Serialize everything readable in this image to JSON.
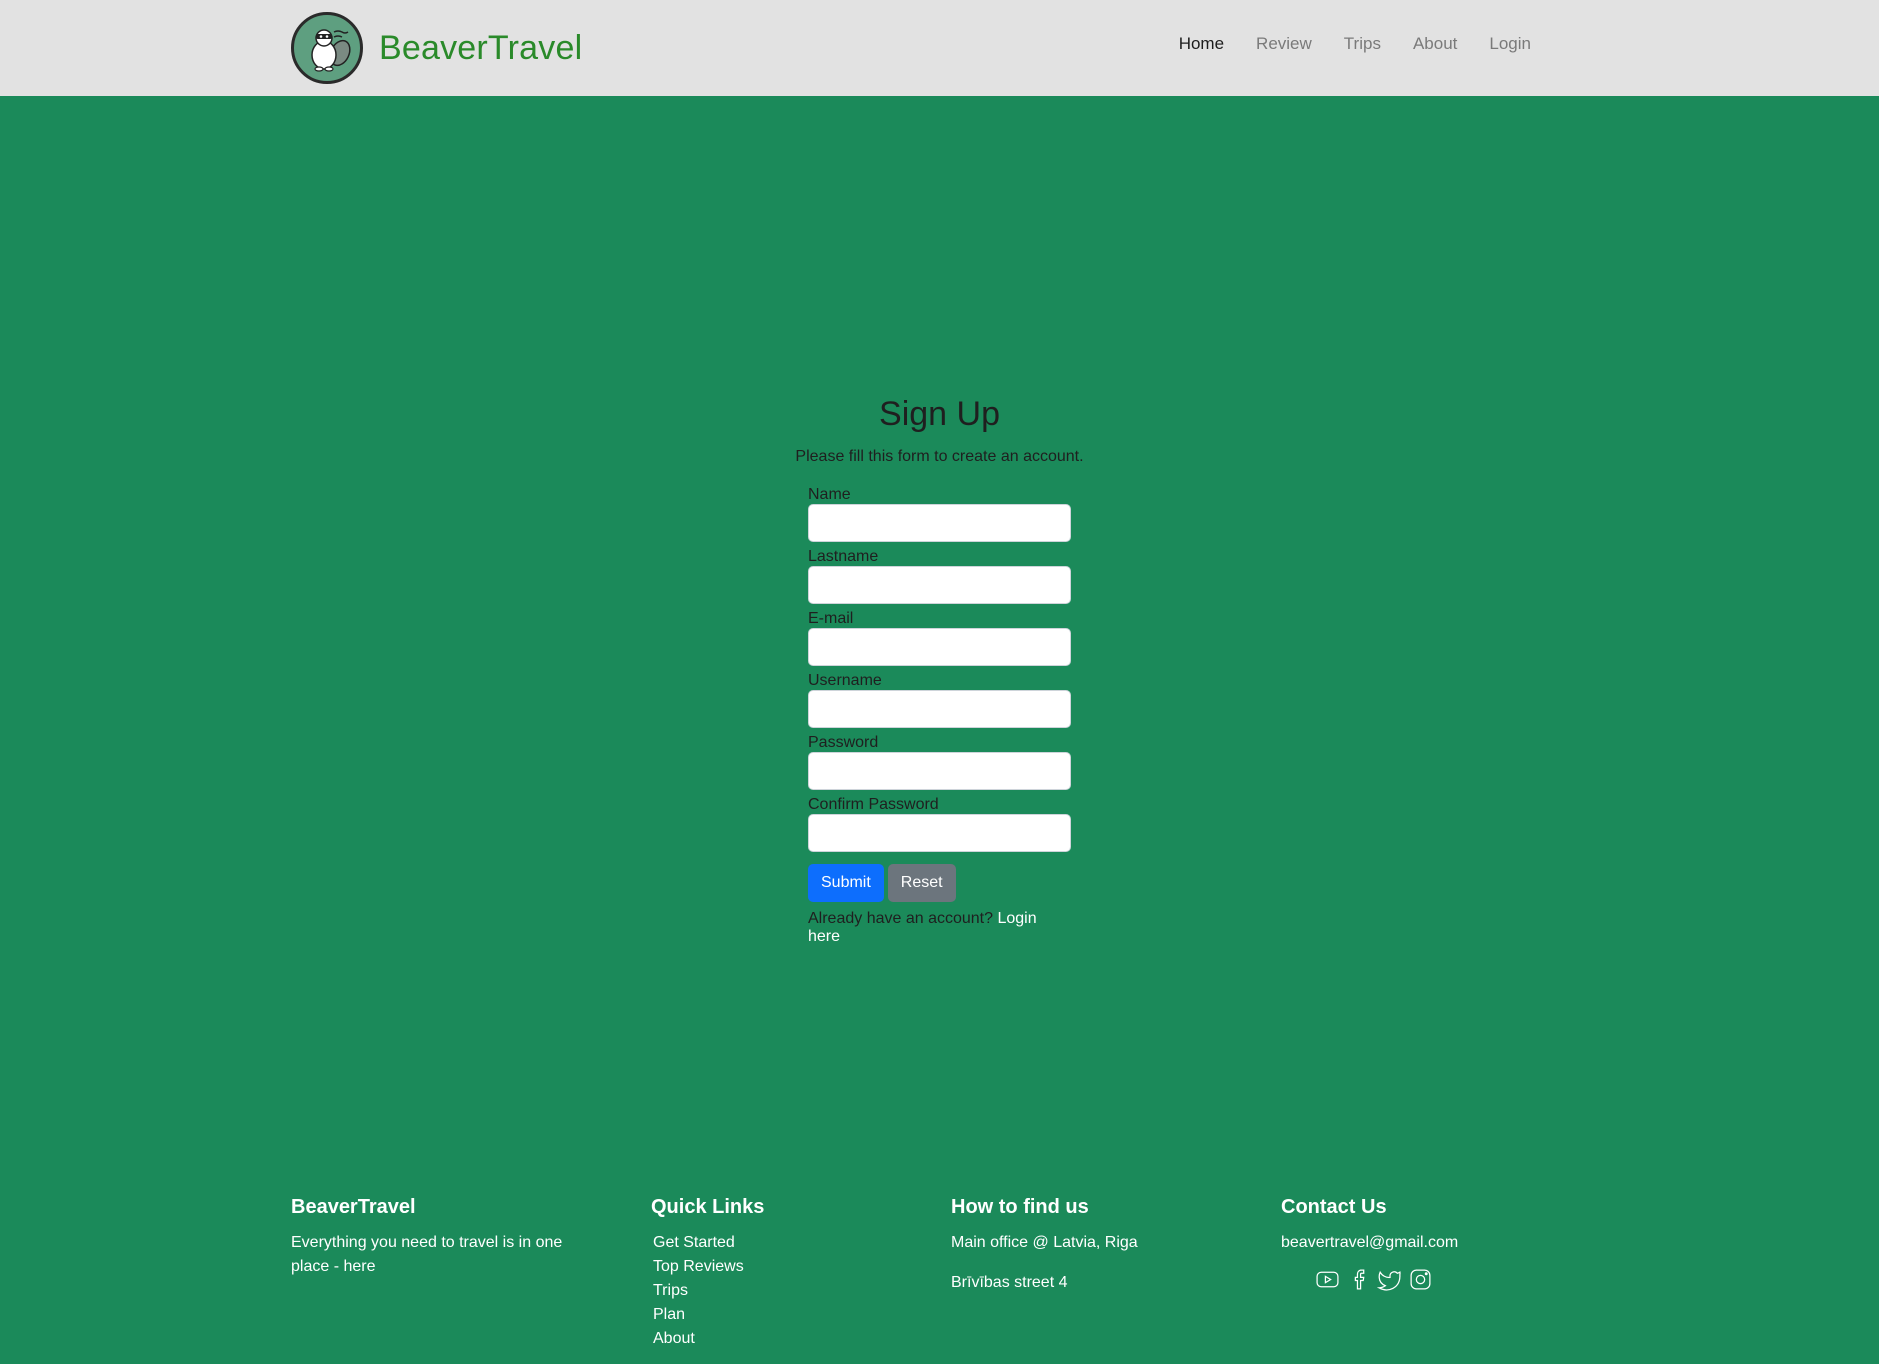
{
  "brand": {
    "name": "BeaverTravel",
    "logo_icon": "beaver-logo-icon"
  },
  "nav": {
    "items": [
      {
        "label": "Home",
        "active": true
      },
      {
        "label": "Review",
        "active": false
      },
      {
        "label": "Trips",
        "active": false
      },
      {
        "label": "About",
        "active": false
      },
      {
        "label": "Login",
        "active": false
      }
    ]
  },
  "signup": {
    "title": "Sign Up",
    "subtitle": "Please fill this form to create an account.",
    "fields": [
      {
        "label": "Name",
        "value": ""
      },
      {
        "label": "Lastname",
        "value": ""
      },
      {
        "label": "E-mail",
        "value": ""
      },
      {
        "label": "Username",
        "value": ""
      },
      {
        "label": "Password",
        "value": ""
      },
      {
        "label": "Confirm Password",
        "value": ""
      }
    ],
    "submit_label": "Submit",
    "reset_label": "Reset",
    "login_prompt": "Already have an account?",
    "login_link": "Login here"
  },
  "footer": {
    "about": {
      "title": "BeaverTravel",
      "text": "Everything you need to travel is in one place - ",
      "link": "here"
    },
    "quick_links": {
      "title": "Quick Links",
      "items": [
        "Get Started",
        "Top Reviews",
        "Trips",
        "Plan",
        "About"
      ]
    },
    "find_us": {
      "title": "How to find us",
      "office": "Main office @ Latvia, Riga",
      "street": "Brīvības street 4"
    },
    "contact": {
      "title": "Contact Us",
      "email": "beavertravel@gmail.com",
      "socials": [
        "youtube-icon",
        "facebook-icon",
        "twitter-icon",
        "instagram-icon"
      ]
    }
  },
  "colors": {
    "page_bg": "#1b8a5a",
    "navbar_bg": "#e2e2e2",
    "brand_text": "#2a8a2a",
    "submit": "#0d6efd",
    "reset": "#6c757d"
  }
}
